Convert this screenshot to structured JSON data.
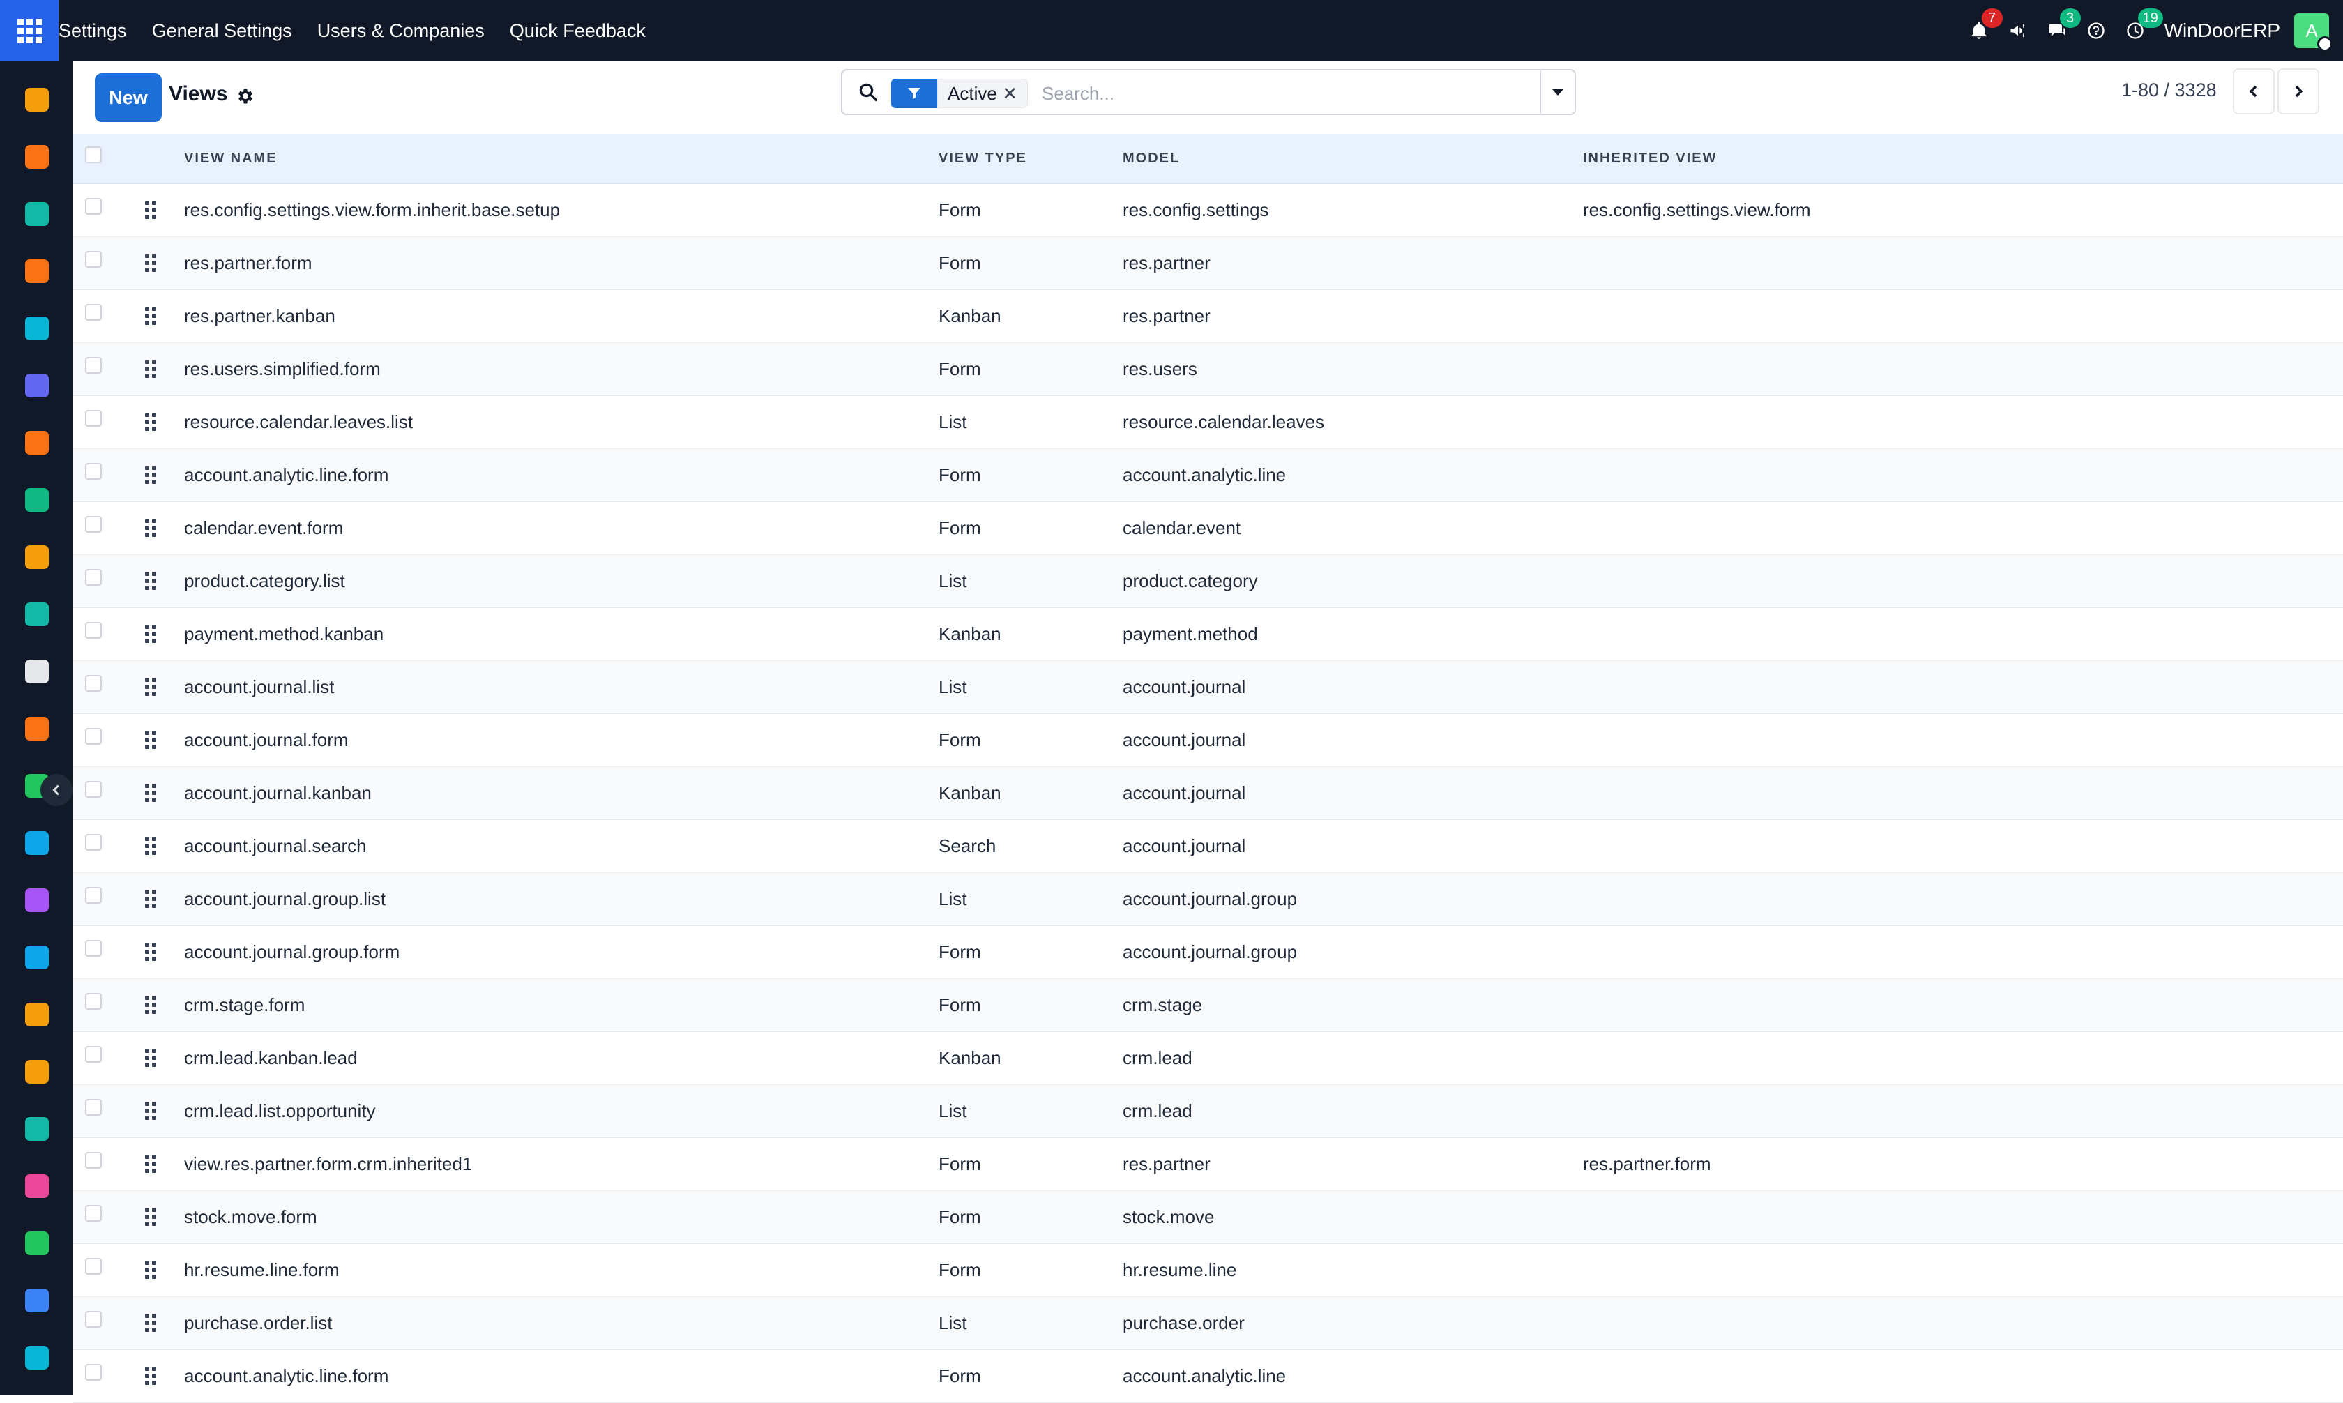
{
  "topbar": {
    "nav": [
      "Settings",
      "General Settings",
      "Users & Companies",
      "Quick Feedback"
    ],
    "notifications_badge": "7",
    "messages_badge": "3",
    "activities_badge": "19",
    "company": "WinDoorERP",
    "avatar_initial": "A"
  },
  "controlbar": {
    "new_label": "New",
    "title": "Views",
    "search": {
      "facet_value": "Active",
      "facet_remove": "✕",
      "placeholder": "Search..."
    },
    "pager": "1-80 / 3328"
  },
  "table": {
    "headers": [
      "View Name",
      "View Type",
      "Model",
      "Inherited View"
    ],
    "rows": [
      {
        "name": "res.config.settings.view.form.inherit.base.setup",
        "type": "Form",
        "model": "res.config.settings",
        "inherited": "res.config.settings.view.form"
      },
      {
        "name": "res.partner.form",
        "type": "Form",
        "model": "res.partner",
        "inherited": ""
      },
      {
        "name": "res.partner.kanban",
        "type": "Kanban",
        "model": "res.partner",
        "inherited": ""
      },
      {
        "name": "res.users.simplified.form",
        "type": "Form",
        "model": "res.users",
        "inherited": ""
      },
      {
        "name": "resource.calendar.leaves.list",
        "type": "List",
        "model": "resource.calendar.leaves",
        "inherited": ""
      },
      {
        "name": "account.analytic.line.form",
        "type": "Form",
        "model": "account.analytic.line",
        "inherited": ""
      },
      {
        "name": "calendar.event.form",
        "type": "Form",
        "model": "calendar.event",
        "inherited": ""
      },
      {
        "name": "product.category.list",
        "type": "List",
        "model": "product.category",
        "inherited": ""
      },
      {
        "name": "payment.method.kanban",
        "type": "Kanban",
        "model": "payment.method",
        "inherited": ""
      },
      {
        "name": "account.journal.list",
        "type": "List",
        "model": "account.journal",
        "inherited": ""
      },
      {
        "name": "account.journal.form",
        "type": "Form",
        "model": "account.journal",
        "inherited": ""
      },
      {
        "name": "account.journal.kanban",
        "type": "Kanban",
        "model": "account.journal",
        "inherited": ""
      },
      {
        "name": "account.journal.search",
        "type": "Search",
        "model": "account.journal",
        "inherited": ""
      },
      {
        "name": "account.journal.group.list",
        "type": "List",
        "model": "account.journal.group",
        "inherited": ""
      },
      {
        "name": "account.journal.group.form",
        "type": "Form",
        "model": "account.journal.group",
        "inherited": ""
      },
      {
        "name": "crm.stage.form",
        "type": "Form",
        "model": "crm.stage",
        "inherited": ""
      },
      {
        "name": "crm.lead.kanban.lead",
        "type": "Kanban",
        "model": "crm.lead",
        "inherited": ""
      },
      {
        "name": "crm.lead.list.opportunity",
        "type": "List",
        "model": "crm.lead",
        "inherited": ""
      },
      {
        "name": "view.res.partner.form.crm.inherited1",
        "type": "Form",
        "model": "res.partner",
        "inherited": "res.partner.form"
      },
      {
        "name": "stock.move.form",
        "type": "Form",
        "model": "stock.move",
        "inherited": ""
      },
      {
        "name": "hr.resume.line.form",
        "type": "Form",
        "model": "hr.resume.line",
        "inherited": ""
      },
      {
        "name": "purchase.order.list",
        "type": "List",
        "model": "purchase.order",
        "inherited": ""
      },
      {
        "name": "account.analytic.line.form",
        "type": "Form",
        "model": "account.analytic.line",
        "inherited": ""
      }
    ]
  },
  "sidebar_apps": [
    {
      "icon": "dashboards-icon",
      "color": "#f59e0b"
    },
    {
      "icon": "knowledge-icon",
      "color": "#f97316"
    },
    {
      "icon": "contacts-icon",
      "color": "#14b8a6"
    },
    {
      "icon": "discuss-icon",
      "color": "#f97316"
    },
    {
      "icon": "planning-icon",
      "color": "#06b6d4"
    },
    {
      "icon": "mail-icon",
      "color": "#6366f1"
    },
    {
      "icon": "livechat-icon",
      "color": "#f97316"
    },
    {
      "icon": "inventory-icon",
      "color": "#10b981"
    },
    {
      "icon": "reporting-icon",
      "color": "#f59e0b"
    },
    {
      "icon": "employees-icon",
      "color": "#14b8a6"
    },
    {
      "icon": "product-icon",
      "color": "#e5e7eb"
    },
    {
      "icon": "knowledge-icon-2",
      "color": "#f97316"
    },
    {
      "icon": "project-icon",
      "color": "#22c55e"
    },
    {
      "icon": "elearning-icon",
      "color": "#0ea5e9"
    },
    {
      "icon": "repair-icon",
      "color": "#a855f7"
    },
    {
      "icon": "invoicing-icon",
      "color": "#0ea5e9"
    },
    {
      "icon": "team-icon",
      "color": "#f59e0b"
    },
    {
      "icon": "calendar-icon",
      "color": "#f59e0b"
    },
    {
      "icon": "sign-icon",
      "color": "#14b8a6"
    },
    {
      "icon": "apps-icon",
      "color": "#ec4899"
    },
    {
      "icon": "whatsapp-icon",
      "color": "#22c55e"
    },
    {
      "icon": "timer-icon",
      "color": "#3b82f6"
    },
    {
      "icon": "planning-icon-2",
      "color": "#06b6d4"
    }
  ]
}
